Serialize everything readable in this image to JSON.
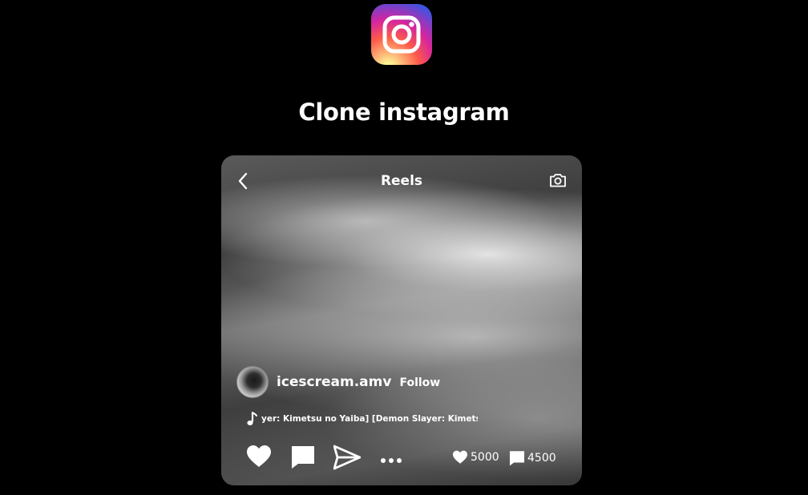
{
  "app": {
    "logo_icon": "instagram-logo",
    "title": "Clone instagram"
  },
  "reel": {
    "header": {
      "back_icon": "chevron-left-icon",
      "title": "Reels",
      "camera_icon": "camera-icon"
    },
    "author": {
      "username": "icescream.amv",
      "follow_label": "Follow"
    },
    "music": {
      "icon": "music-note-icon",
      "track": "yer: Kimetsu no Yaiba] [Demon Slayer: Kimetsu"
    },
    "actions": {
      "like_icon": "heart-icon",
      "comment_icon": "comment-icon",
      "share_icon": "send-icon",
      "more_icon": "more-icon"
    },
    "stats": {
      "likes": "5000",
      "comments": "4500"
    }
  },
  "colors": {
    "background": "#000000",
    "text": "#ffffff"
  }
}
